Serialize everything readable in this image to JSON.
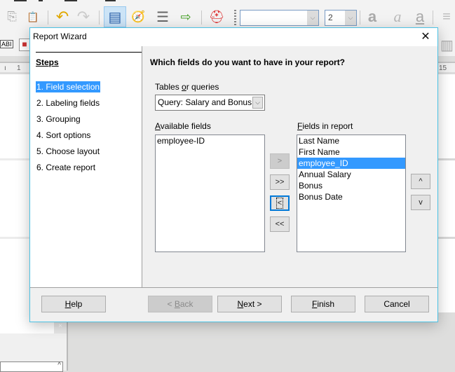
{
  "app": {
    "toolbar": {
      "icons": [
        "copy-icon",
        "paste-icon",
        "undo-icon",
        "redo-icon",
        "table-icon",
        "navigator-icon",
        "form-icon",
        "import-icon",
        "help-lifebuoy-icon"
      ],
      "font_name_value": "",
      "font_size_value": "2",
      "format_icons": [
        "bold-a-icon",
        "italic-a-icon",
        "underline-a-icon",
        "align-icon"
      ],
      "glyphs": {
        "copy": "⎘",
        "paste": "📋",
        "undo": "↶",
        "redo": "↷",
        "table": "▤",
        "navigator": "🧭",
        "form": "☰",
        "import": "⇨",
        "help": "⛑",
        "bold": "a",
        "italic": "a",
        "underline": "a",
        "align": "≡",
        "dropdown": "⌵",
        "chart": "▥",
        "scroll_up": "^"
      }
    },
    "row2_label": "ABI",
    "ruler_left": "1",
    "ruler_right": "15"
  },
  "dialog": {
    "title": "Report Wizard",
    "close_glyph": "✕",
    "steps_title": "Steps",
    "steps": [
      {
        "label": "1. Field selection",
        "selected": true
      },
      {
        "label": "2. Labeling fields",
        "selected": false
      },
      {
        "label": "3. Grouping",
        "selected": false
      },
      {
        "label": "4. Sort options",
        "selected": false
      },
      {
        "label": "5. Choose layout",
        "selected": false
      },
      {
        "label": "6. Create report",
        "selected": false
      }
    ],
    "question": "Which fields do you want to have in your report?",
    "tables_label_pre": "Tables ",
    "tables_label_u": "o",
    "tables_label_post": "r queries",
    "tables_value": "Query: Salary and Bonus",
    "available_label_u": "A",
    "available_label_post": "vailable fields",
    "available_fields": [
      "employee-ID"
    ],
    "report_label_u": "F",
    "report_label_post": "ields in report",
    "report_fields": [
      {
        "label": "Last Name",
        "selected": false
      },
      {
        "label": "First Name",
        "selected": false
      },
      {
        "label": "employee_ID",
        "selected": true
      },
      {
        "label": "Annual Salary",
        "selected": false
      },
      {
        "label": "Bonus",
        "selected": false
      },
      {
        "label": "Bonus Date",
        "selected": false
      }
    ],
    "move_buttons": {
      "add_one": ">",
      "add_all": ">>",
      "remove_one": "<",
      "remove_all": "<<",
      "up": "^",
      "down": "v"
    },
    "footer": {
      "help_u": "H",
      "help_post": "elp",
      "back_pre": "< ",
      "back_u": "B",
      "back_post": "ack",
      "next_u": "N",
      "next_post": "ext >",
      "finish_u": "F",
      "finish_post": "inish",
      "cancel": "Cancel"
    }
  }
}
